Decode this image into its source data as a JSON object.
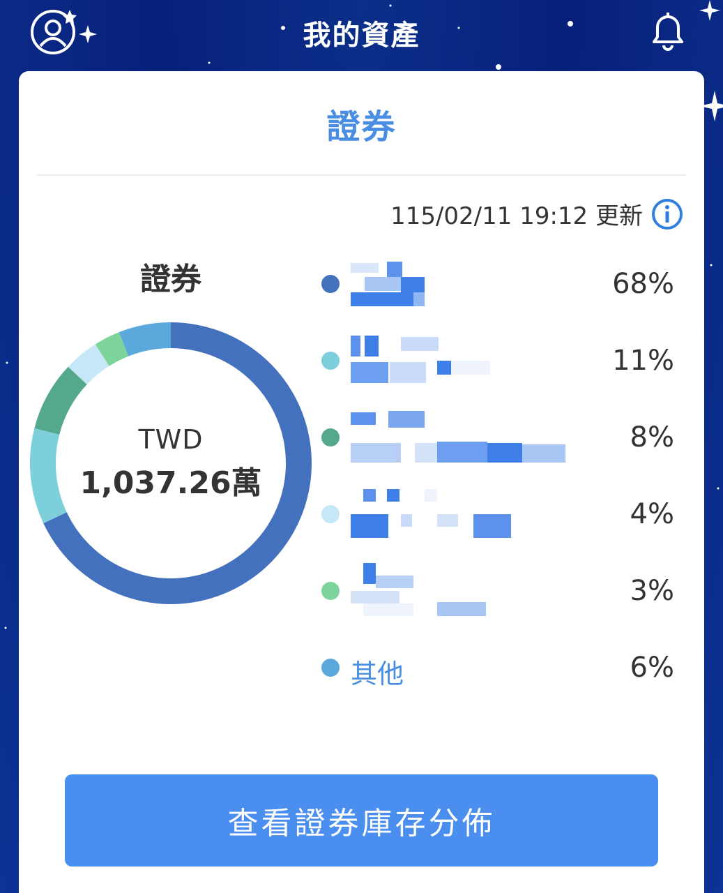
{
  "header": {
    "title": "我的資產",
    "profile_icon": "user-star-icon",
    "bell_icon": "bell-icon"
  },
  "card": {
    "tab": "證券",
    "updated_at": "115/02/11 19:12 更新",
    "info_icon": "info-icon",
    "section_label": "證券",
    "currency": "TWD",
    "total": "1,037.26萬",
    "cta_label": "查看證券庫存分佈"
  },
  "colors": {
    "accent": "#4a8ee3",
    "button": "#4a8ef0",
    "series": [
      "#4471bd",
      "#7ecfdc",
      "#54a98c",
      "#c6e7f8",
      "#7dd49b",
      "#5ba8dc"
    ]
  },
  "legend": [
    {
      "name": "",
      "pct": "68%"
    },
    {
      "name": "",
      "pct": "11%"
    },
    {
      "name": "",
      "pct": "8%"
    },
    {
      "name": "",
      "pct": "4%"
    },
    {
      "name": "",
      "pct": "3%"
    },
    {
      "name": "其他",
      "pct": "6%"
    }
  ],
  "chart_data": {
    "type": "pie",
    "categories": [
      "",
      "",
      "",
      "",
      "",
      "其他"
    ],
    "values": [
      68,
      11,
      8,
      4,
      3,
      6
    ],
    "colors": [
      "#4471bd",
      "#7ecfdc",
      "#54a98c",
      "#c6e7f8",
      "#7dd49b",
      "#5ba8dc"
    ]
  }
}
